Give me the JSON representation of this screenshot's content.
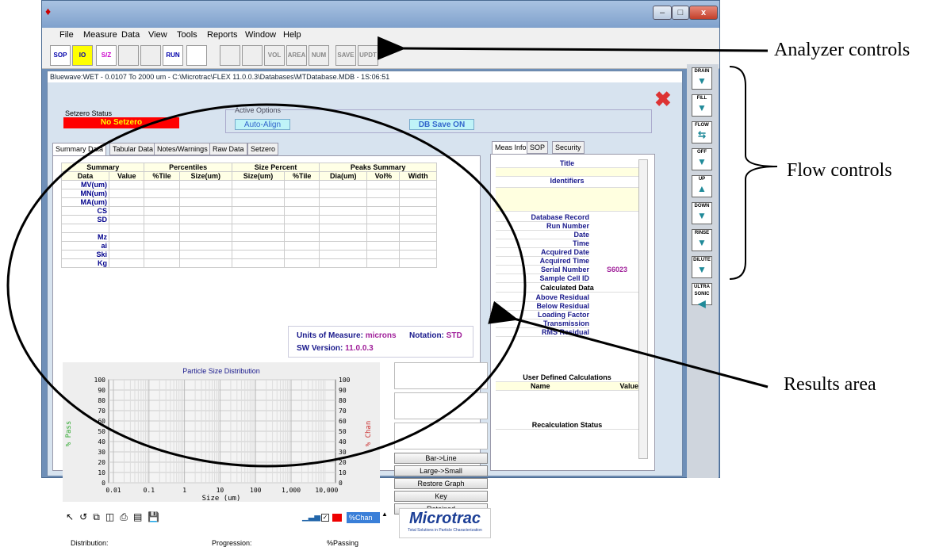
{
  "window": {
    "child_title": "Bluewave:WET - 0.0107 To 2000 um - C:\\Microtrac\\FLEX 11.0.0.3\\Databases\\MTDatabase.MDB - 1S:06:51"
  },
  "menu": [
    "File",
    "Measure",
    "Data",
    "View",
    "Tools",
    "Reports",
    "Window",
    "Help"
  ],
  "toolbar": [
    "SOP",
    "IO",
    "S/Z",
    "",
    "",
    "RUN",
    "",
    "",
    "",
    "VOL",
    "AREA",
    "NUM",
    "SAVE",
    "UPDT"
  ],
  "status": {
    "setzero_label": "Setzero Status",
    "setzero_value": "No Setzero",
    "active_label": "Active Options",
    "auto_align": "Auto-Align",
    "db_save": "DB Save ON"
  },
  "tabs": [
    "Summary Data",
    "Tabular Data",
    "Notes/Warnings",
    "Raw Data",
    "Setzero"
  ],
  "summary_table": {
    "groups": [
      "Summary",
      "Percentiles",
      "Size Percent",
      "Peaks Summary"
    ],
    "columns": [
      "Data",
      "Value",
      "%Tile",
      "Size(um)",
      "Size(um)",
      "%Tile",
      "Dia(um)",
      "Vol%",
      "Width"
    ],
    "rows": [
      "MV(um)",
      "MN(um)",
      "MA(um)",
      "CS",
      "SD",
      "",
      "Mz",
      "ai",
      "Ski",
      "Kg"
    ]
  },
  "units": {
    "label": "Units of Measure:",
    "value": "microns",
    "notation_label": "Notation:",
    "notation_value": "STD",
    "sw_label": "SW Version:",
    "sw_value": "11.0.0.3"
  },
  "chart_data": {
    "type": "line",
    "title": "Particle Size Distribution",
    "xlabel": "Size (um)",
    "ylabel": "% Pass",
    "y2label": "% Chan",
    "xscale": "log",
    "xticks": [
      "0.01",
      "0.1",
      "1",
      "10",
      "100",
      "1,000",
      "10,000"
    ],
    "yticks": [
      "0",
      "10",
      "20",
      "30",
      "40",
      "50",
      "60",
      "70",
      "80",
      "90",
      "100"
    ],
    "ylim": [
      0,
      100
    ],
    "grid": true,
    "series": []
  },
  "side_buttons": [
    "Bar->Line",
    "Large->Small",
    "Restore Graph",
    "Key",
    "Retained"
  ],
  "chan_ctrl": {
    "value": "%Chan"
  },
  "logo": {
    "name": "Microtrac",
    "tagline": "Total Solutions in Particle Characterization"
  },
  "footer": {
    "distribution": "Distribution:",
    "progression": "Progression:",
    "passing": "%Passing"
  },
  "right_tabs": [
    "Meas Info",
    "SOP",
    "Security"
  ],
  "meas_info": {
    "title": "Title",
    "identifiers": "Identifiers",
    "fields": [
      "Database Record",
      "Run Number",
      "Date",
      "Time",
      "Acquired Date",
      "Acquired Time",
      "Serial Number",
      "Sample Cell ID"
    ],
    "serial": "S6023",
    "calculated": "Calculated Data",
    "calc_fields": [
      "Above Residual",
      "Below Residual",
      "Loading Factor",
      "Transmission",
      "RMS Residual"
    ],
    "user_defined": "User Defined Calculations",
    "ud_name": "Name",
    "ud_value": "Value",
    "recalc": "Recalculation Status"
  },
  "flow_buttons": [
    "DRAIN",
    "FILL",
    "FLOW",
    "OFF",
    "UP",
    "DOWN",
    "RINSE",
    "DILUTE",
    "ULTRA SONIC"
  ],
  "annotations": {
    "analyzer": "Analyzer controls",
    "flow": "Flow controls",
    "results": "Results area"
  },
  "colors": {
    "accent": "#208a99",
    "alert": "#ff0000",
    "navy": "#1a1a8c",
    "purple": "#a0209a"
  }
}
